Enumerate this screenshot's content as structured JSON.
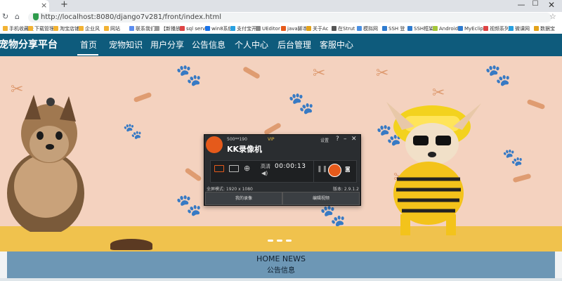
{
  "browser": {
    "tab_close": "×",
    "new_tab": "+",
    "url": "http://localhost:8080/django7v281/front/index.html",
    "bookmarks": [
      "手机收藏夹",
      "下载管理",
      "淘宝店铺",
      "企业风",
      "网站",
      "联系我们",
      "【新播放",
      "sql server",
      "win8系统",
      "支付宝开",
      "UEditor",
      "java脚本",
      "关于Ac",
      "在Strut",
      "模拟网",
      "SSH 登",
      "SSH框架",
      "Android",
      "MyEclip",
      "视频系列",
      "微课网",
      "数据宝"
    ]
  },
  "site": {
    "title": "宠物分享平台",
    "nav": [
      "首页",
      "宠物知识",
      "用户分享",
      "公告信息",
      "个人中心",
      "后台管理",
      "客服中心"
    ]
  },
  "recorder": {
    "resolution": "500**190",
    "vip": "VIP",
    "title": "KK录像机",
    "settings": "设置",
    "help": "?",
    "minimize": "–",
    "close": "✕",
    "quality": "高清",
    "timer": "00:00:13",
    "mode": "全屏模式: 1920 x 1080",
    "version": "版本: 2.9.1.2",
    "my_recordings": "我的录像",
    "edit_video": "编辑视频"
  },
  "news": {
    "title_en": "HOME NEWS",
    "title_zh": "公告信息"
  },
  "colors": {
    "nav_bg": "#0e5b7c",
    "hero_bg": "#f4d2bf",
    "accent": "#e55a1b",
    "news_bg": "#6d97b5"
  }
}
